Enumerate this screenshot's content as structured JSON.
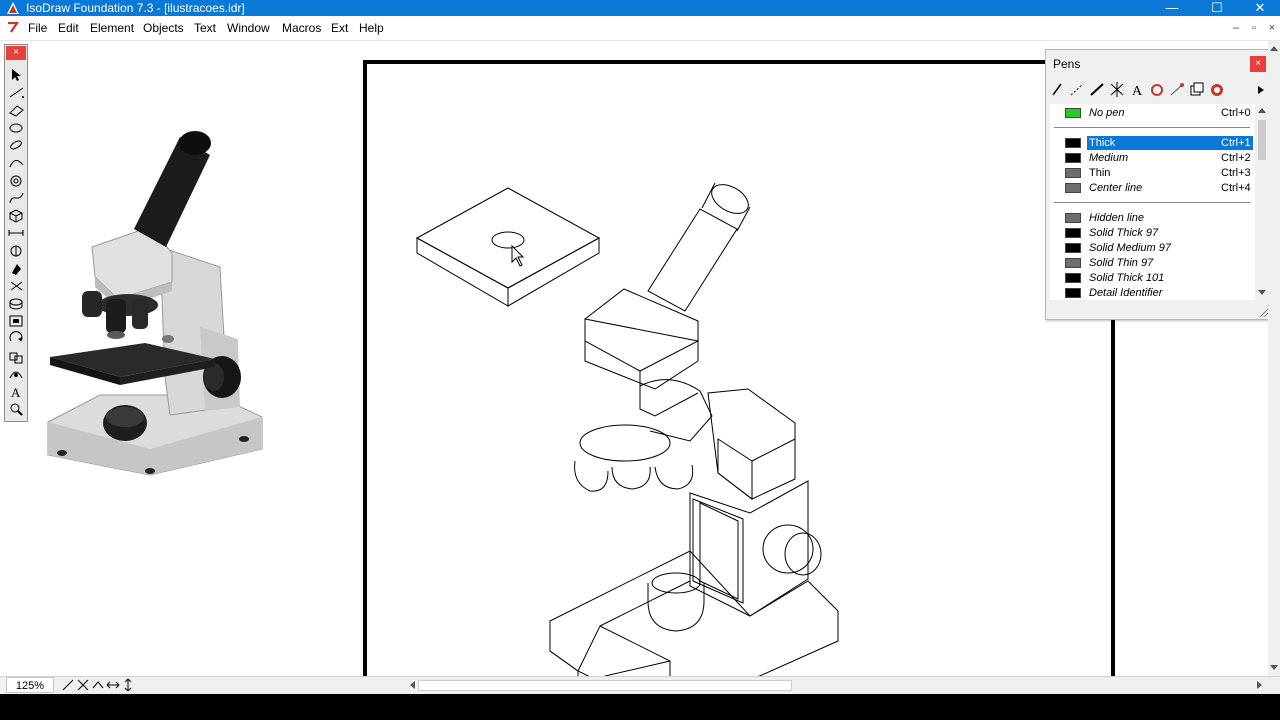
{
  "window": {
    "title": "IsoDraw Foundation 7.3 - [ilustracoes.idr]",
    "controls": [
      "—",
      "☐",
      "✕"
    ]
  },
  "menubar": {
    "items": [
      "File",
      "Edit",
      "Element",
      "Objects",
      "Text",
      "Window",
      "Macros",
      "Ext",
      "Help"
    ],
    "mdi_controls": [
      "–",
      "▫",
      "×"
    ]
  },
  "tool_palette": {
    "close": "×",
    "tools": [
      "select-arrow-icon",
      "line-tool-icon",
      "rectangle-tool-icon",
      "ellipse-tool-icon",
      "isometric-ellipse-icon",
      "spline-tool-icon",
      "circle-tool-icon",
      "bezier-tool-icon",
      "box-tool-icon",
      "dimension-tool-icon",
      "cut-tool-icon",
      "fill-tool-icon",
      "move-tool-icon",
      "cylinder-tool-icon",
      "scale-tool-icon",
      "rotate-tool-icon",
      "group-tool-icon",
      "hotspot-tool-icon",
      "text-tool-icon",
      "zoom-tool-icon"
    ]
  },
  "pens_palette": {
    "title": "Pens",
    "close": "×",
    "pens": [
      {
        "name": "No pen",
        "key": "Ctrl+0",
        "italic": true,
        "color": "#22cc22",
        "group": 1
      },
      {
        "name": "Thick",
        "key": "Ctrl+1",
        "italic": false,
        "color": "#000000",
        "group": 2,
        "selected": true
      },
      {
        "name": "Medium",
        "key": "Ctrl+2",
        "italic": true,
        "color": "#000000",
        "group": 2
      },
      {
        "name": "Thin",
        "key": "Ctrl+3",
        "italic": false,
        "color": "#6e6e6e",
        "group": 2
      },
      {
        "name": "Center line",
        "key": "Ctrl+4",
        "italic": true,
        "color": "#6e6e6e",
        "group": 2
      },
      {
        "name": "Hidden line",
        "key": "",
        "italic": true,
        "color": "#6e6e6e",
        "group": 3
      },
      {
        "name": "Solid Thick 97",
        "key": "",
        "italic": true,
        "color": "#000000",
        "group": 3
      },
      {
        "name": "Solid Medium 97",
        "key": "",
        "italic": true,
        "color": "#000000",
        "group": 3
      },
      {
        "name": "Solid Thin 97",
        "key": "",
        "italic": true,
        "color": "#6e6e6e",
        "group": 3
      },
      {
        "name": "Solid Thick 101",
        "key": "",
        "italic": true,
        "color": "#000000",
        "group": 3
      },
      {
        "name": "Detail Identifier",
        "key": "",
        "italic": true,
        "color": "#000000",
        "group": 3
      }
    ]
  },
  "statusbar": {
    "zoom": "125%"
  },
  "colors": {
    "titlebar": "#0a78d7",
    "selection": "#0a78d7",
    "close_red": "#e8413b"
  }
}
